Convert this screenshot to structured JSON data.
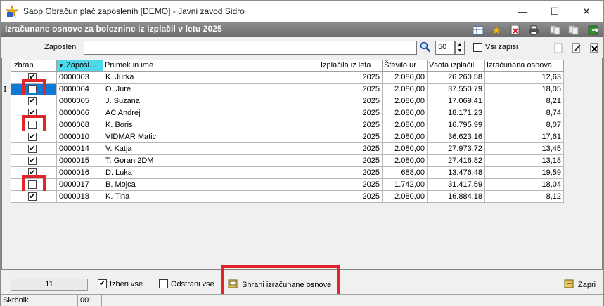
{
  "window": {
    "title": "Saop Obračun plač zaposlenih [DEMO] - Javni zavod Sidro"
  },
  "header": {
    "title": "Izračunane osnove za boleznine iz izplačil v letu 2025"
  },
  "filter": {
    "zaposleni_label": "Zaposleni",
    "zaposleni_value": "",
    "count_value": "50",
    "vsi_zapisi_label": "Vsi zapisi",
    "vsi_zapisi_checked": false
  },
  "table": {
    "columns": [
      "Izbran",
      "Zaposl…",
      "Priimek in ime",
      "Izplačila iz leta",
      "Število ur",
      "Vsota izplačil",
      "Izračunana osnova"
    ],
    "rows": [
      {
        "izbran": true,
        "zap": "0000003",
        "ime": "K. Jurka",
        "leto": "2025",
        "ure": "2.080,00",
        "vsota": "26.260,58",
        "osnova": "12,63",
        "highlight": false,
        "current": false
      },
      {
        "izbran": false,
        "zap": "0000004",
        "ime": "O. Jure",
        "leto": "2025",
        "ure": "2.080,00",
        "vsota": "37.550,79",
        "osnova": "18,05",
        "highlight": true,
        "current": true
      },
      {
        "izbran": true,
        "zap": "0000005",
        "ime": "J. Suzana",
        "leto": "2025",
        "ure": "2.080,00",
        "vsota": "17.069,41",
        "osnova": "8,21",
        "highlight": false,
        "current": false
      },
      {
        "izbran": true,
        "zap": "0000006",
        "ime": "AC Andrej",
        "leto": "2025",
        "ure": "2.080,00",
        "vsota": "18.171,23",
        "osnova": "8,74",
        "highlight": false,
        "current": false
      },
      {
        "izbran": false,
        "zap": "0000008",
        "ime": "K. Boris",
        "leto": "2025",
        "ure": "2.080,00",
        "vsota": "16.795,99",
        "osnova": "8,07",
        "highlight": true,
        "current": false
      },
      {
        "izbran": true,
        "zap": "0000010",
        "ime": "VIDMAR Matic",
        "leto": "2025",
        "ure": "2.080,00",
        "vsota": "36.623,16",
        "osnova": "17,61",
        "highlight": false,
        "current": false
      },
      {
        "izbran": true,
        "zap": "0000014",
        "ime": "V. Katja",
        "leto": "2025",
        "ure": "2.080,00",
        "vsota": "27.973,72",
        "osnova": "13,45",
        "highlight": false,
        "current": false
      },
      {
        "izbran": true,
        "zap": "0000015",
        "ime": "T. Goran 2DM",
        "leto": "2025",
        "ure": "2.080,00",
        "vsota": "27.416,82",
        "osnova": "13,18",
        "highlight": false,
        "current": false
      },
      {
        "izbran": true,
        "zap": "0000016",
        "ime": "D. Luka",
        "leto": "2025",
        "ure": "688,00",
        "vsota": "13.476,48",
        "osnova": "19,59",
        "highlight": false,
        "current": false
      },
      {
        "izbran": false,
        "zap": "0000017",
        "ime": "B.  Mojca",
        "leto": "2025",
        "ure": "1.742,00",
        "vsota": "31.417,59",
        "osnova": "18,04",
        "highlight": true,
        "current": false
      },
      {
        "izbran": true,
        "zap": "0000018",
        "ime": "K. Tina",
        "leto": "2025",
        "ure": "2.080,00",
        "vsota": "16.884,18",
        "osnova": "8,12",
        "highlight": false,
        "current": false
      }
    ]
  },
  "bottom": {
    "count": "11",
    "izberi_vse": "Izberi vse",
    "izberi_vse_checked": true,
    "odstrani_vse": "Odstrani vse",
    "odstrani_vse_checked": false,
    "shrani": "Shrani izračunane osnove",
    "zapri": "Zapri"
  },
  "status": {
    "left": "Skrbnik",
    "middle": "001"
  },
  "colors": {
    "header_band": "#7a7a7a",
    "sorted_header": "#4fd8ec",
    "selection": "#0c7bd8",
    "annotation": "#e0262b"
  }
}
